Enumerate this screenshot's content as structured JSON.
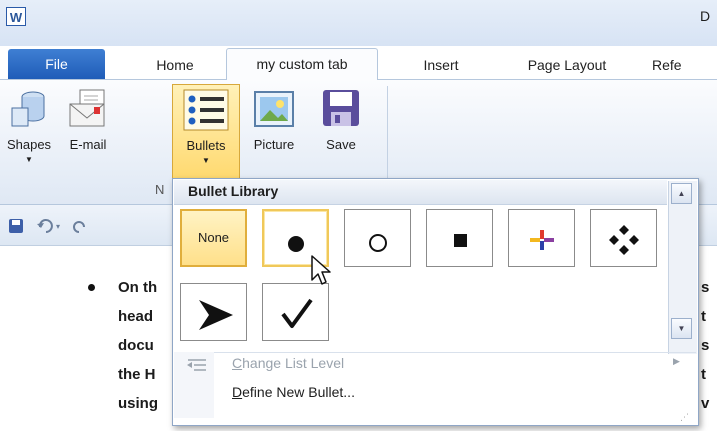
{
  "app": {
    "icon_letter": "W",
    "title_fragment": "D"
  },
  "tabs": {
    "file": "File",
    "home": "Home",
    "custom": "my custom tab",
    "insert": "Insert",
    "page_layout": "Page Layout",
    "references": "Refe"
  },
  "ribbon": {
    "buttons": [
      {
        "label": "Shapes",
        "icon": "shapes-icon",
        "has_dropdown": true
      },
      {
        "label": "E-mail",
        "icon": "email-icon",
        "has_dropdown": false
      },
      {
        "label": "Bullets",
        "icon": "bullets-icon",
        "has_dropdown": true
      },
      {
        "label": "Picture",
        "icon": "picture-icon",
        "has_dropdown": false
      },
      {
        "label": "Save",
        "icon": "save-icon",
        "has_dropdown": false
      }
    ],
    "group_label": "N"
  },
  "quick_access": [
    "save-icon",
    "undo-icon",
    "redo-icon"
  ],
  "document": {
    "lines": [
      "On th",
      "head",
      "docu",
      "the H",
      "using"
    ],
    "right_fragments": [
      "s",
      "t",
      "s",
      "t",
      "v"
    ]
  },
  "gallery": {
    "title": "Bullet Library",
    "none_label": "None",
    "bullets": [
      "none",
      "filled-circle",
      "hollow-circle",
      "filled-square",
      "four-color-star",
      "four-diamond",
      "arrowhead",
      "checkmark"
    ],
    "selected": "none",
    "hovered": "filled-circle",
    "menu": {
      "change_level": "Change List Level",
      "change_level_enabled": false,
      "define_new": "Define New Bullet..."
    }
  },
  "colors": {
    "file_tab": "#2b66c1",
    "highlight": "#ffd769",
    "ribbon": "#dfe8f4"
  }
}
